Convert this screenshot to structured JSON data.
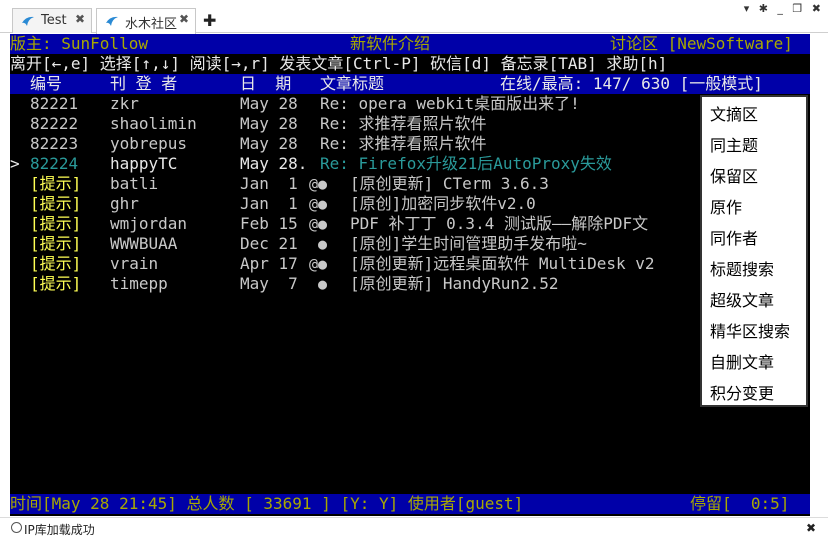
{
  "tabs": [
    {
      "label": "Test",
      "close": "✖"
    },
    {
      "label": "水木社区",
      "close": "✖"
    }
  ],
  "new_tab": "✚",
  "window_controls": "▾ ✱ _ ❐ ✖",
  "terminal": {
    "header": {
      "moderator": "版主: SunFollow",
      "board_title": "新软件介绍",
      "board": "讨论区 [NewSoftware]"
    },
    "help": "离开[←,e] 选择[↑,↓] 阅读[→,r] 发表文章[Ctrl-P] 砍信[d] 备忘录[TAB] 求助[h]",
    "columns": {
      "num": "编号",
      "author": "刊 登 者",
      "date": "日  期",
      "title": "文章标题",
      "online": "在线/最高: 147/ 630 [一般模式]"
    },
    "articles": [
      {
        "cursor": "",
        "num": "82221",
        "author": "zkr",
        "date": "May 28",
        "mark": "",
        "title": "Re: opera webkit桌面版出来了!"
      },
      {
        "cursor": "",
        "num": "82222",
        "author": "shaolimin",
        "date": "May 28",
        "mark": "",
        "title": "Re: 求推荐看照片软件"
      },
      {
        "cursor": "",
        "num": "82223",
        "author": "yobrepus",
        "date": "May 28",
        "mark": "",
        "title": "Re: 求推荐看照片软件"
      },
      {
        "cursor": ">",
        "num": "82224",
        "author": "happyTC",
        "date": "May 28.",
        "mark": "",
        "title": "Re: Firefox升级21后AutoProxy失效"
      }
    ],
    "sticky": [
      {
        "num": "[提示]",
        "author": "batli",
        "date": "Jan  1",
        "mark": "@●",
        "title": "[原创更新] CTerm 3.6.3"
      },
      {
        "num": "[提示]",
        "author": "ghr",
        "date": "Jan  1",
        "mark": "@●",
        "title": "[原创]加密同步软件v2.0"
      },
      {
        "num": "[提示]",
        "author": "wmjordan",
        "date": "Feb 15",
        "mark": "@●",
        "title": "PDF 补丁丁 0.3.4 测试版——解除PDF文"
      },
      {
        "num": "[提示]",
        "author": "WWWBUAA",
        "date": "Dec 21",
        "mark": " ●",
        "title": "[原创]学生时间管理助手发布啦~"
      },
      {
        "num": "[提示]",
        "author": "vrain",
        "date": "Apr 17",
        "mark": "@●",
        "title": "[原创更新]远程桌面软件 MultiDesk v2"
      },
      {
        "num": "[提示]",
        "author": "timepp",
        "date": "May  7",
        "mark": " ●",
        "title": "[原创更新] HandyRun2.52"
      }
    ],
    "status": {
      "left": "时间[May 28 21:45] 总人数 [ 33691 ] [Y: Y] 使用者[guest]",
      "right": "停留[  0:5]"
    }
  },
  "menu": [
    "文摘区",
    "同主题",
    "保留区",
    "原作",
    "同作者",
    "标题搜索",
    "超级文章",
    "精华区搜索",
    "自删文章",
    "积分变更"
  ],
  "bottom": {
    "status": "IP库加载成功",
    "close": "✖"
  },
  "colors": {
    "terminal_bg": "#000000",
    "bar_bg": "#0000a8",
    "header_fg": "#a8a800",
    "hint_fg": "#ffff54",
    "selected_fg": "#2a9a9a"
  }
}
